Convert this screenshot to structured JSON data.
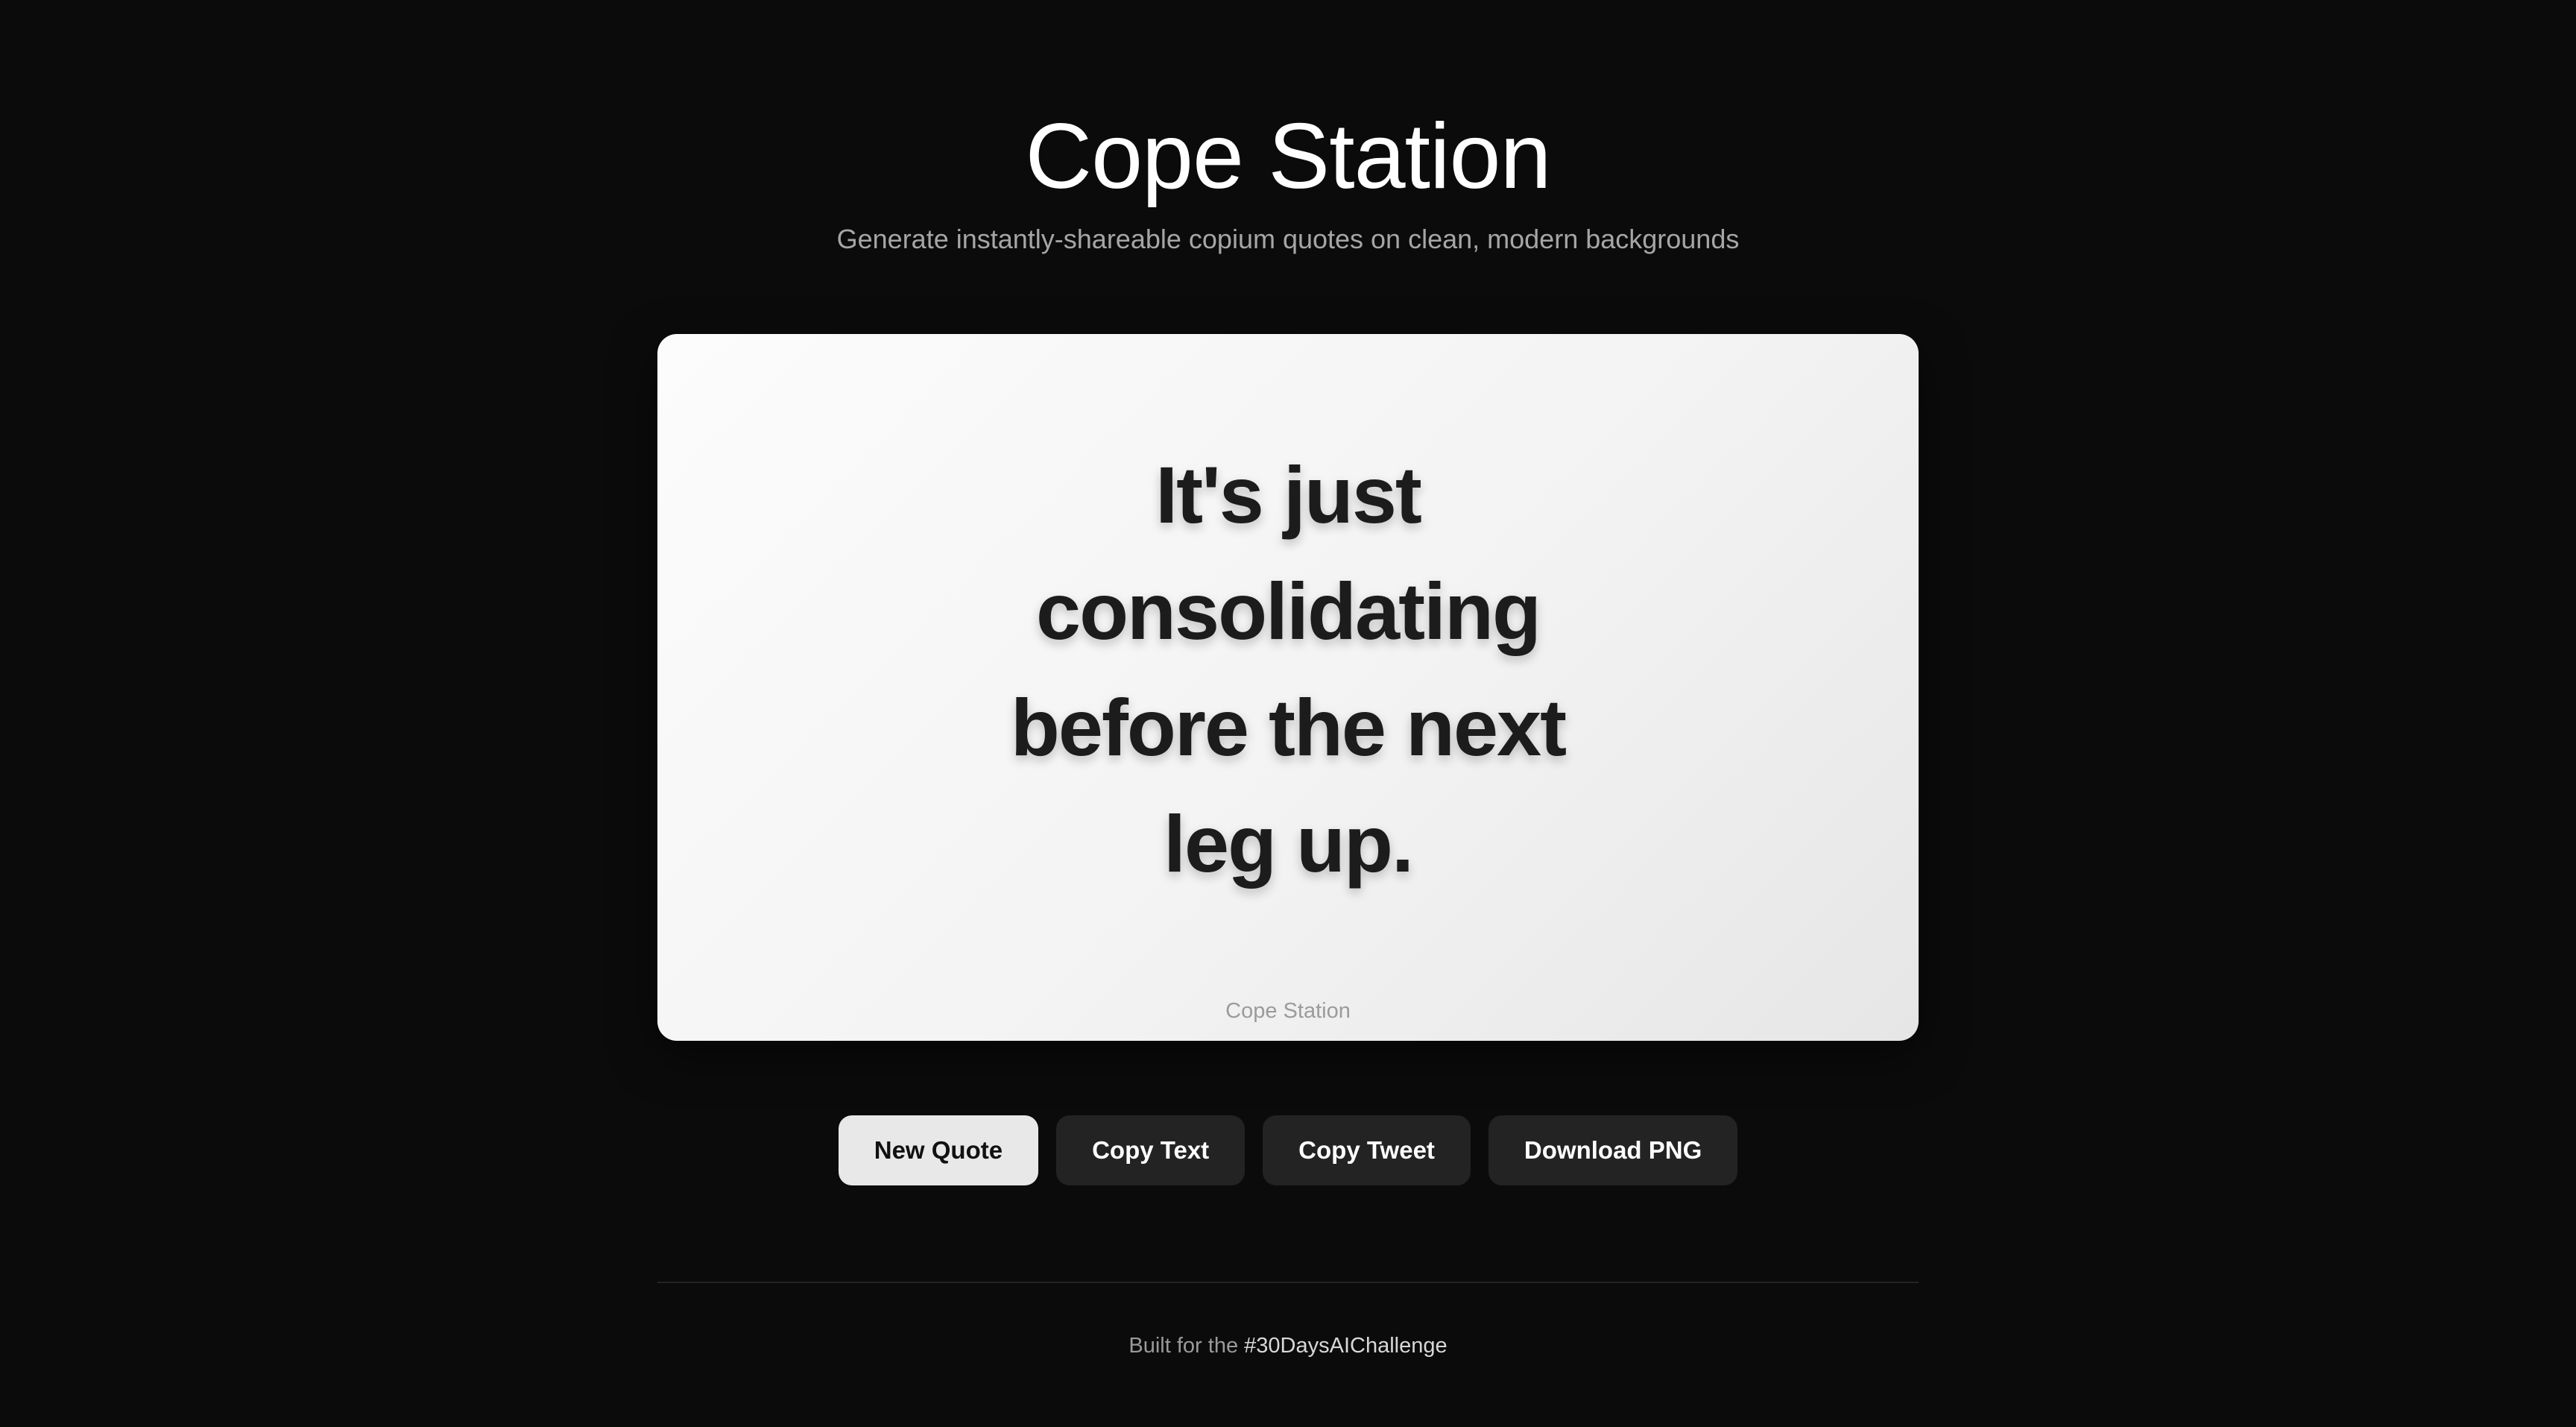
{
  "header": {
    "title": "Cope Station",
    "subtitle": "Generate instantly-shareable copium quotes on clean, modern backgrounds"
  },
  "card": {
    "quote_lines": [
      "It's just",
      "consolidating",
      "before the next",
      "leg up."
    ],
    "watermark": "Cope Station"
  },
  "actions": {
    "new_quote": "New Quote",
    "copy_text": "Copy Text",
    "copy_tweet": "Copy Tweet",
    "download_png": "Download PNG"
  },
  "footer": {
    "prefix": "Built for the ",
    "hashtag": "#30DaysAIChallenge"
  },
  "colors": {
    "background": "#0b0b0b",
    "card_light": "#fcfcfc",
    "card_dark": "#e6e6e6",
    "primary_button": "#e8e8e8",
    "secondary_button": "#232323"
  }
}
